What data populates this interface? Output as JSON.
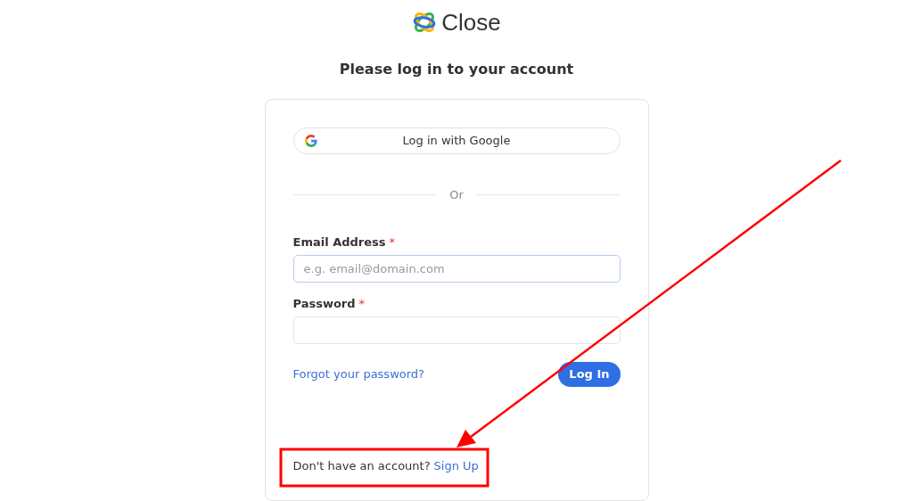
{
  "logo": {
    "text": "Close"
  },
  "heading": "Please log in to your account",
  "google_button": {
    "label": "Log in with Google"
  },
  "divider": "Or",
  "fields": [
    {
      "label": "Email Address",
      "mark": "*",
      "placeholder": "e.g. email@domain.com",
      "focused": true
    },
    {
      "label": "Password",
      "mark": "*",
      "focused": false
    }
  ],
  "forgot_link": "Forgot your password?",
  "login_button": "Log In",
  "signup": {
    "text": "Don't have an account?",
    "link": "Sign Up"
  }
}
